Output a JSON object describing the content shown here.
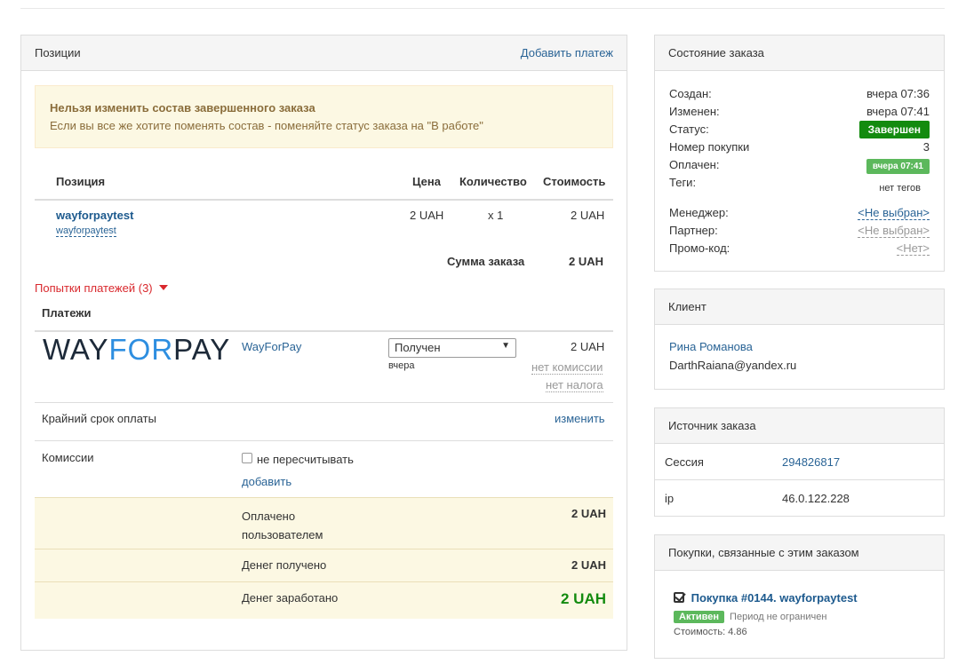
{
  "positions_panel": {
    "title": "Позиции",
    "add_payment": "Добавить платеж",
    "alert_title": "Нельзя изменить состав завершенного заказа",
    "alert_text": "Если вы все же хотите поменять состав - поменяйте статус заказа на \"В работе\"",
    "table": {
      "headers": {
        "position": "Позиция",
        "price": "Цена",
        "quantity": "Количество",
        "cost": "Стоимость"
      },
      "rows": [
        {
          "name": "wayforpaytest",
          "sub": "wayforpaytest",
          "price": "2 UAH",
          "quantity": "x 1",
          "cost": "2 UAH"
        }
      ],
      "total_label": "Сумма заказа",
      "total_value": "2 UAH"
    },
    "payment_attempts": "Попытки платежей (3)",
    "payments_title": "Платежи",
    "payment": {
      "logo_text_1": "WAY",
      "logo_text_2": "FOR",
      "logo_text_3": "PAY",
      "provider": "WayForPay",
      "status": "Получен",
      "date": "вчера",
      "amount": "2 UAH",
      "no_commission": "нет комиссии",
      "no_tax": "нет налога"
    },
    "deadline_label": "Крайний срок оплаты",
    "deadline_change": "изменить",
    "commissions_label": "Комиссии",
    "no_recalc": "не пересчитывать",
    "add": "добавить",
    "summary": [
      {
        "label": "Оплачено пользователем",
        "value": "2 UAH"
      },
      {
        "label": "Денег получено",
        "value": "2 UAH"
      },
      {
        "label": "Денег заработано",
        "value": "2 UAH"
      }
    ]
  },
  "order_state": {
    "title": "Состояние заказа",
    "created_label": "Создан:",
    "created": "вчера 07:36",
    "changed_label": "Изменен:",
    "changed": "вчера 07:41",
    "status_label": "Статус:",
    "status": "Завершен",
    "purchase_no_label": "Номер покупки",
    "purchase_no": "3",
    "paid_label": "Оплачен:",
    "paid": "вчера 07:41",
    "tags_label": "Теги:",
    "tags": "нет тегов",
    "manager_label": "Менеджер:",
    "manager": "<Не выбран>",
    "partner_label": "Партнер:",
    "partner": "<Не выбран>",
    "promo_label": "Промо-код:",
    "promo": "<Нет>",
    "colors": {
      "status": "#138b0f",
      "paid": "#5cb85c"
    }
  },
  "client": {
    "title": "Клиент",
    "name": "Рина Романова",
    "email": "DarthRaiana@yandex.ru"
  },
  "source": {
    "title": "Источник заказа",
    "session_label": "Сессия",
    "session": "294826817",
    "ip_label": "ip",
    "ip": "46.0.122.228"
  },
  "related": {
    "title": "Покупки, связанные с этим заказом",
    "purchase": "Покупка #0144. wayforpaytest",
    "badge": "Активен",
    "period": "Период не ограничен",
    "cost": "Стоимость: 4.86"
  }
}
